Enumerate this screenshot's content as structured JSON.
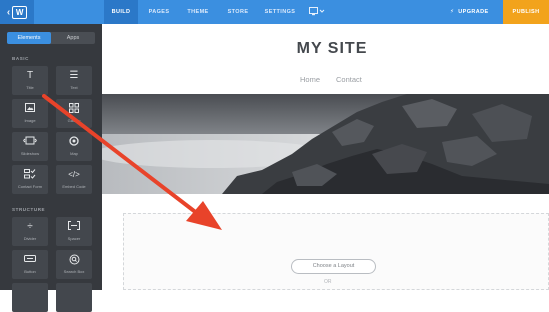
{
  "topbar": {
    "tabs": [
      {
        "label": "BUILD",
        "active": true
      },
      {
        "label": "PAGES",
        "active": false
      },
      {
        "label": "THEME",
        "active": false
      },
      {
        "label": "STORE",
        "active": false
      },
      {
        "label": "SETTINGS",
        "active": false
      }
    ],
    "upgrade_label": "UPGRADE",
    "publish_label": "PUBLISH",
    "accent_color": "#3b8fe0",
    "publish_color": "#f2a31c"
  },
  "sidebar": {
    "toggle": {
      "elements_label": "Elements",
      "apps_label": "Apps",
      "selected": "Elements"
    },
    "sections": [
      {
        "title": "BASIC",
        "items": [
          {
            "label": "Title",
            "icon": "title-icon"
          },
          {
            "label": "Text",
            "icon": "text-icon"
          },
          {
            "label": "Image",
            "icon": "image-icon"
          },
          {
            "label": "Gallery",
            "icon": "gallery-icon"
          },
          {
            "label": "Slideshow",
            "icon": "slideshow-icon"
          },
          {
            "label": "Map",
            "icon": "map-icon"
          },
          {
            "label": "Contact Form",
            "icon": "contact-form-icon"
          },
          {
            "label": "Embed Code",
            "icon": "embed-code-icon"
          }
        ]
      },
      {
        "title": "STRUCTURE",
        "items": [
          {
            "label": "Divider",
            "icon": "divider-icon"
          },
          {
            "label": "Spacer",
            "icon": "spacer-icon"
          },
          {
            "label": "Button",
            "icon": "button-icon"
          },
          {
            "label": "Search Box",
            "icon": "search-box-icon"
          }
        ]
      }
    ]
  },
  "site": {
    "title": "MY SITE",
    "nav": [
      "Home",
      "Contact"
    ],
    "choose_layout_label": "Choose a Layout",
    "or_label": "OR"
  },
  "annotation": {
    "arrow_color": "#e8432a"
  }
}
